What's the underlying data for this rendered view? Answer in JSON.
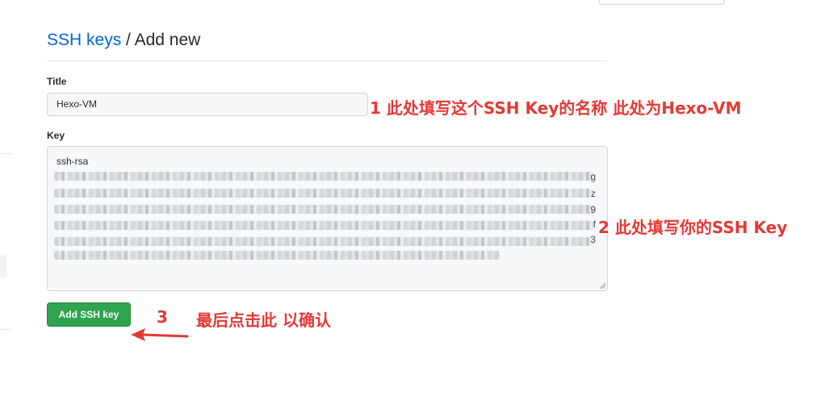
{
  "breadcrumb": {
    "link": "SSH keys",
    "separator": " / ",
    "current": "Add new"
  },
  "form": {
    "title_label": "Title",
    "title_value": "Hexo-VM",
    "key_label": "Key",
    "key_prefix": "ssh-rsa",
    "key_line_endings": [
      "g",
      "z",
      "9",
      "f",
      "3"
    ],
    "submit_label": "Add SSH key"
  },
  "annotations": {
    "step1": "1    此处填写这个SSH Key的名称 此处为Hexo-VM",
    "step2": "2  此处填写你的SSH Key",
    "step3_number": "3",
    "step3_text": "最后点击此 以确认"
  },
  "colors": {
    "link": "#0366d6",
    "primary_button": "#2ea44f",
    "annotation": "#e53935"
  }
}
